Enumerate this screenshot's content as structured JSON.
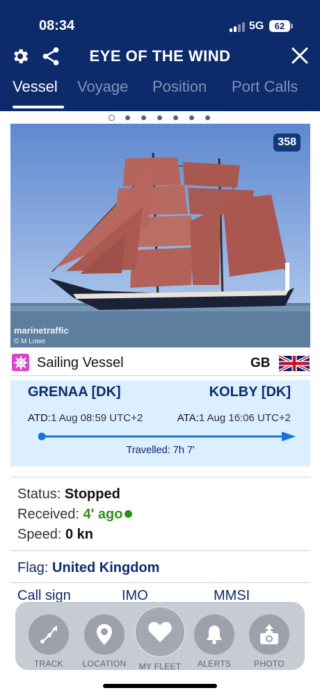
{
  "status_bar": {
    "time": "08:34",
    "network": "5G",
    "battery": "62"
  },
  "header": {
    "title": "EYE OF THE WIND",
    "tabs": [
      {
        "label": "Vessel",
        "active": true
      },
      {
        "label": "Voyage",
        "active": false
      },
      {
        "label": "Position",
        "active": false
      },
      {
        "label": "Port Calls",
        "active": false
      }
    ]
  },
  "carousel": {
    "page_count": 7,
    "active_index": 0
  },
  "photo": {
    "count": "358",
    "watermark": "marinetraffic",
    "credit": "© M Lowe"
  },
  "vessel": {
    "type": "Sailing Vessel",
    "country_code": "GB"
  },
  "voyage": {
    "from_port": "GRENAA [DK]",
    "to_port": "KOLBY [DK]",
    "atd_label": "ATD:",
    "atd_value": "1 Aug 08:59 UTC+2",
    "ata_label": "ATA:",
    "ata_value": "1 Aug 16:06 UTC+2",
    "travelled": "Travelled: 7h 7'"
  },
  "status": {
    "status_label": "Status:",
    "status_value": "Stopped",
    "received_label": "Received:",
    "received_value": "4' ago",
    "speed_label": "Speed:",
    "speed_value": "0 kn"
  },
  "flag": {
    "label": "Flag:",
    "value": "United Kingdom"
  },
  "identifiers": {
    "call_sign": "Call sign",
    "imo": "IMO",
    "mmsi": "MMSI"
  },
  "bottom_nav": {
    "track": "TRACK",
    "location": "LOCATION",
    "my_fleet": "MY FLEET",
    "alerts": "ALERTS",
    "photo": "PHOTO"
  },
  "colors": {
    "header_bg": "#0d2a6b",
    "accent_blue": "#0d2a6b",
    "progress_blue": "#1a73d9",
    "online_green": "#2f8f1a",
    "voyage_bg": "#dcefff"
  }
}
